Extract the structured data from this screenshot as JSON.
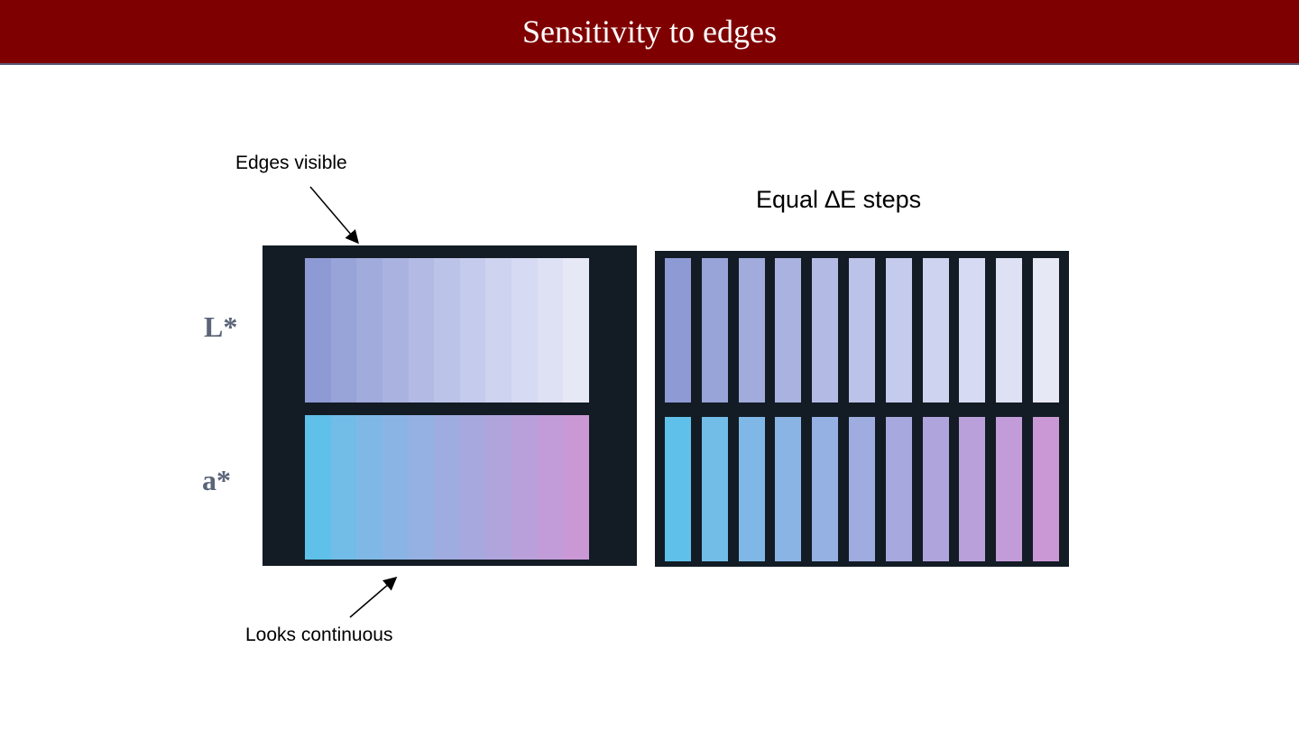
{
  "slide": {
    "title": "Sensitivity to edges"
  },
  "annotations": {
    "edges_visible": "Edges visible",
    "looks_continuous": "Looks continuous",
    "equal_steps": "Equal ∆E steps"
  },
  "axis_labels": {
    "lightness": "L*",
    "redgreen": "a*"
  },
  "colors": {
    "title_bar": "#7f0000",
    "panel_background": "#131c24",
    "l_star_steps": [
      "#8e9ad4",
      "#98a3d8",
      "#a1abdc",
      "#aab3e0",
      "#b3bbe4",
      "#bcc3e8",
      "#c5cbec",
      "#ced3ef",
      "#d6daf2",
      "#dee1f4",
      "#e6e8f6"
    ],
    "a_star_steps": [
      "#5fc0ea",
      "#72bce8",
      "#7fb8e6",
      "#8ab4e4",
      "#95b0e2",
      "#9eace0",
      "#a7a8de",
      "#b0a4dc",
      "#b9a0da",
      "#c29cd8",
      "#cb98d6"
    ]
  }
}
